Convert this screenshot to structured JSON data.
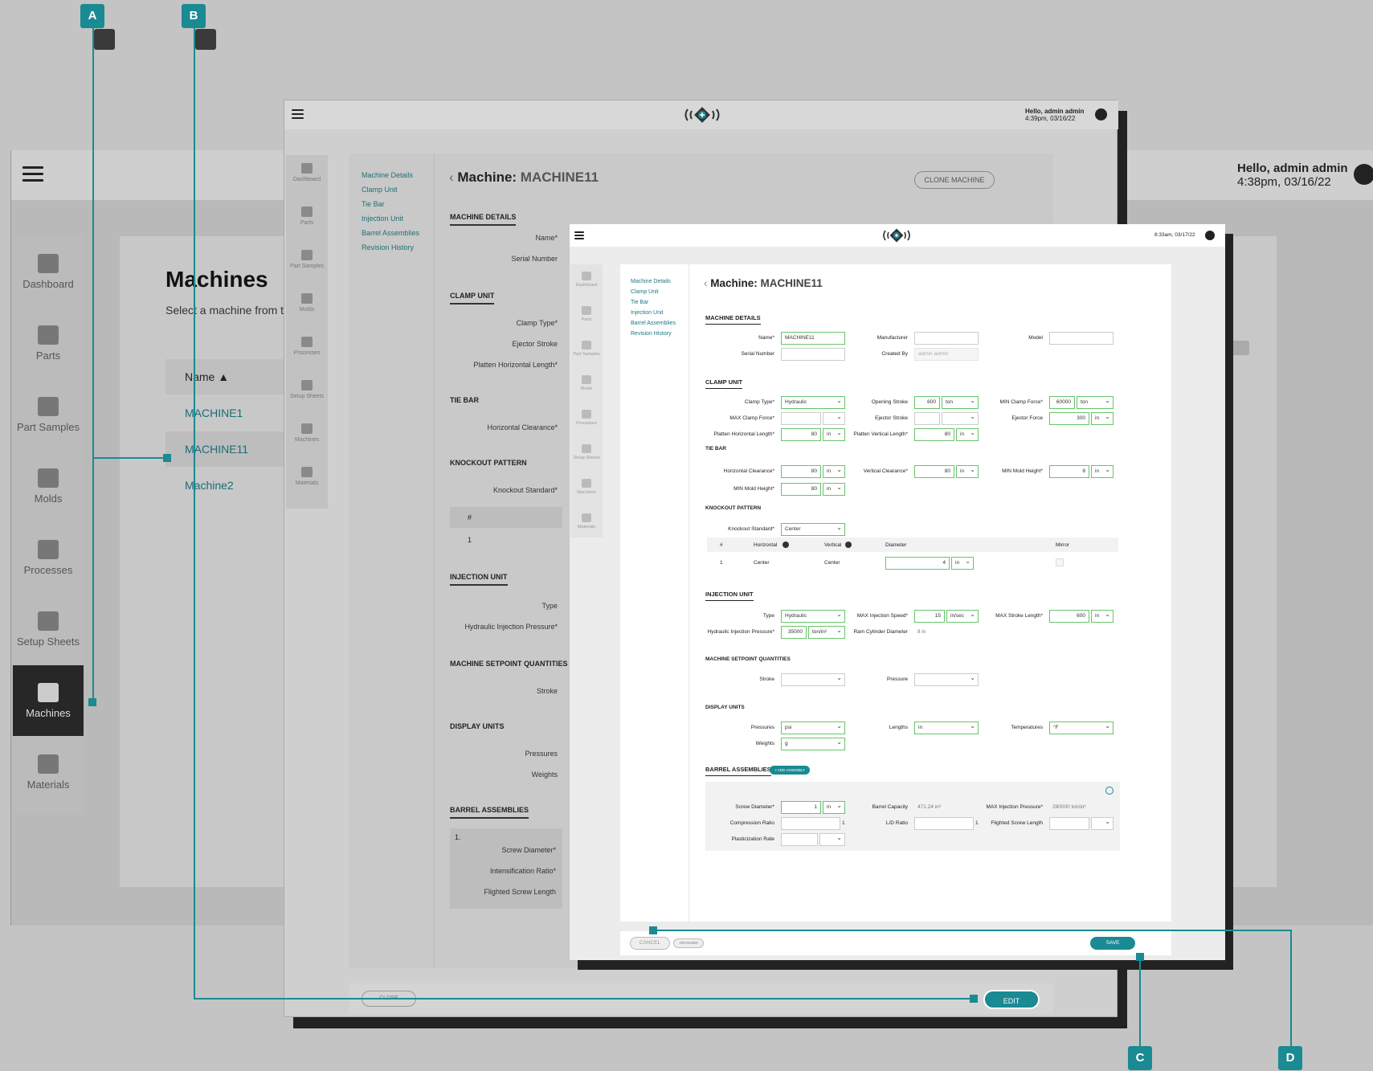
{
  "back": {
    "greeting": "Hello, admin admin",
    "time": "4:38pm, 03/16/22",
    "sidebar": [
      "Dashboard",
      "Parts",
      "Part Samples",
      "Molds",
      "Processes",
      "Setup Sheets",
      "Machines",
      "Materials"
    ],
    "title": "Machines",
    "subtitle": "Select a machine from th",
    "col_name": "Name ▲",
    "machines": [
      "MACHINE1",
      "MACHINE11",
      "Machine2"
    ]
  },
  "mid": {
    "greeting": "Hello, admin admin",
    "time": "4:39pm, 03/16/22",
    "sidebar": [
      "Dashboard",
      "Parts",
      "Part Samples",
      "Molds",
      "Processes",
      "Setup Sheets",
      "Machines",
      "Materials"
    ],
    "nav": [
      "Machine Details",
      "Clamp Unit",
      "Tie Bar",
      "Injection Unit",
      "Barrel Assemblies",
      "Revision History"
    ],
    "title_prefix": "Machine: ",
    "title_name": "MACHINE11",
    "clone": "CLONE MACHINE",
    "sections": {
      "machine_details": "MACHINE DETAILS",
      "clamp_unit": "CLAMP UNIT",
      "tie_bar": "TIE BAR",
      "knockout": "KNOCKOUT PATTERN",
      "injection": "INJECTION UNIT",
      "setpoint": "MACHINE SETPOINT QUANTITIES",
      "display": "DISPLAY UNITS",
      "barrel": "BARREL ASSEMBLIES"
    },
    "labels": {
      "name": "Name*",
      "serial": "Serial Number",
      "clamp_type": "Clamp Type*",
      "ejector_stroke": "Ejector Stroke",
      "platen_h": "Platten Horizontal Length*",
      "horiz_clear": "Horizontal Clearance*",
      "ko_std": "Knockout Standard*",
      "hash": "#",
      "one": "1",
      "type": "Type",
      "hyd_press": "Hydraulic Injection Pressure*",
      "stroke": "Stroke",
      "pressures": "Pressures",
      "weights": "Weights",
      "b1": "1.",
      "screw_dia": "Screw Diameter*",
      "intens": "Intensification Ratio*",
      "flighted": "Flighted Screw Length"
    },
    "close": "CLOSE",
    "edit": "EDIT"
  },
  "front": {
    "time": "8:33am, 03/17/22",
    "sidebar": [
      "Dashboard",
      "Parts",
      "Part Samples",
      "Molds",
      "Processes",
      "Setup Sheets",
      "Machines",
      "Materials"
    ],
    "nav": [
      "Machine Details",
      "Clamp Unit",
      "Tie Bar",
      "Injection Unit",
      "Barrel Assemblies",
      "Revision History"
    ],
    "title_prefix": "Machine: ",
    "title_name": "MACHINE11",
    "sections": {
      "machine_details": "MACHINE DETAILS",
      "clamp_unit": "CLAMP UNIT",
      "tie_bar": "TIE BAR",
      "knockout": "KNOCKOUT PATTERN",
      "injection": "INJECTION UNIT",
      "setpoint": "MACHINE SETPOINT QUANTITIES",
      "display": "DISPLAY UNITS",
      "barrel": "BARREL ASSEMBLIES"
    },
    "details": {
      "name_label": "Name*",
      "name_value": "MACHINE11",
      "manufacturer_label": "Manufacturer",
      "model_label": "Model",
      "serial_label": "Serial Number",
      "created_label": "Created By",
      "created_value": "admin admin"
    },
    "clamp": {
      "clamp_type_label": "Clamp Type*",
      "clamp_type": "Hydraulic",
      "opening_label": "Opening Stroke",
      "opening_value": "600",
      "opening_unit": "ton",
      "min_clamp_label": "MIN Clamp Force*",
      "min_clamp_value": "60000",
      "min_clamp_unit": "ton",
      "max_clamp_label": "MAX Clamp Force*",
      "ejector_stroke_label": "Ejector Stroke",
      "ejector_force_label": "Ejector Force",
      "ejector_force_value": "300",
      "ejector_force_unit": "in",
      "platen_h_label": "Platten Horizontal Length*",
      "platen_h_value": "80",
      "platen_h_unit": "in",
      "platen_v_label": "Platten Vertical Length*",
      "platen_v_value": "80",
      "platen_v_unit": "in"
    },
    "tiebar": {
      "h_label": "Horizontal Clearance*",
      "h_value": "80",
      "h_unit": "in",
      "v_label": "Vertical Clearance*",
      "v_value": "80",
      "v_unit": "in",
      "min_mold_label": "MIN Mold Height*",
      "min_mold_value": "8",
      "min_mold_unit": "in",
      "min_mold2_label": "MIN Mold Height*",
      "min_mold2_value": "80",
      "min_mold2_unit": "in"
    },
    "knockout": {
      "std_label": "Knockout Standard*",
      "std_value": "Center",
      "headers": [
        "#",
        "Horizontal",
        "Vertical",
        "Diameter",
        "Mirror"
      ],
      "row": {
        "num": "1",
        "horizontal": "Center",
        "vertical": "Center",
        "diameter": "4",
        "unit": "in"
      }
    },
    "injection": {
      "type_label": "Type",
      "type_value": "Hydraulic",
      "max_speed_label": "MAX Injection Speed*",
      "max_speed_value": "15",
      "max_speed_unit": "in/sec",
      "max_stroke_label": "MAX Stroke Length*",
      "max_stroke_value": "600",
      "max_stroke_unit": "in",
      "hyd_label": "Hydraulic Injection Pressure*",
      "hyd_value": "35000",
      "hyd_unit": "ton/in²",
      "ram_label": "Ram Cylinder Diameter",
      "ram_value": "8 in"
    },
    "setpoint": {
      "stroke_label": "Stroke",
      "pressure_label": "Pressure"
    },
    "display": {
      "pressures_label": "Pressures",
      "pressures": "psi",
      "lengths_label": "Lengths",
      "lengths": "in",
      "temps_label": "Temperatures",
      "temps": "°F",
      "weights_label": "Weights",
      "weights": "g"
    },
    "barrel": {
      "add": "+ ADD ASSEMBLY",
      "screw_label": "Screw Diameter*",
      "screw_value": "1",
      "screw_unit": "in",
      "capacity_label": "Barrel Capacity",
      "capacity_value": "471.24 in³",
      "max_inj_label": "MAX Injection Pressure*",
      "max_inj_value": "280000 ton/in²",
      "comp_label": "Compression Ratio",
      "comp_suffix": "1",
      "ld_label": "L/D Ratio",
      "ld_suffix": "1",
      "flighted_label": "Flighted Screw Length",
      "plast_label": "Plasticization Rate"
    },
    "cancel": "CANCEL",
    "archived": "ARCHIVED",
    "save": "SAVE"
  },
  "callouts": [
    "A",
    "B",
    "C",
    "D"
  ],
  "colors": {
    "accent": "#1a8a93",
    "valid": "#67c56b",
    "dark": "#272727"
  }
}
